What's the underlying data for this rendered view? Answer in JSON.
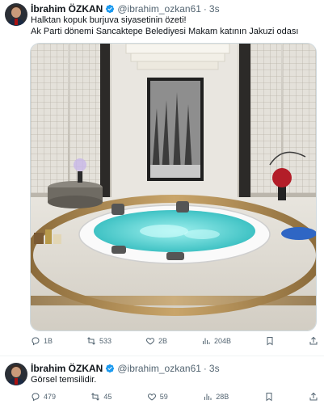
{
  "tweets": [
    {
      "author_name": "İbrahim ÖZKAN",
      "handle": "@ibrahim_ozkan61",
      "separator": "·",
      "time": "3s",
      "text_line1": "Halktan kopuk burjuva siyasetinin özeti!",
      "text_line2": "Ak Parti dönemi Sancaktepe Belediyesi Makam katının Jakuzi odası",
      "actions": {
        "replies": "1B",
        "retweets": "533",
        "likes": "2B",
        "views": "204B"
      }
    },
    {
      "author_name": "İbrahim ÖZKAN",
      "handle": "@ibrahim_ozkan61",
      "separator": "·",
      "time": "3s",
      "text_line1": "Görsel temsilidir.",
      "actions": {
        "replies": "479",
        "retweets": "45",
        "likes": "59",
        "views": "28B"
      }
    }
  ],
  "colors": {
    "verified": "#1d9bf0",
    "secondary_text": "#536471",
    "water": "#5fd3d3"
  },
  "icons": [
    "avatar",
    "verified-badge-icon",
    "reply-icon",
    "retweet-icon",
    "like-icon",
    "views-icon",
    "bookmark-icon",
    "share-icon"
  ]
}
